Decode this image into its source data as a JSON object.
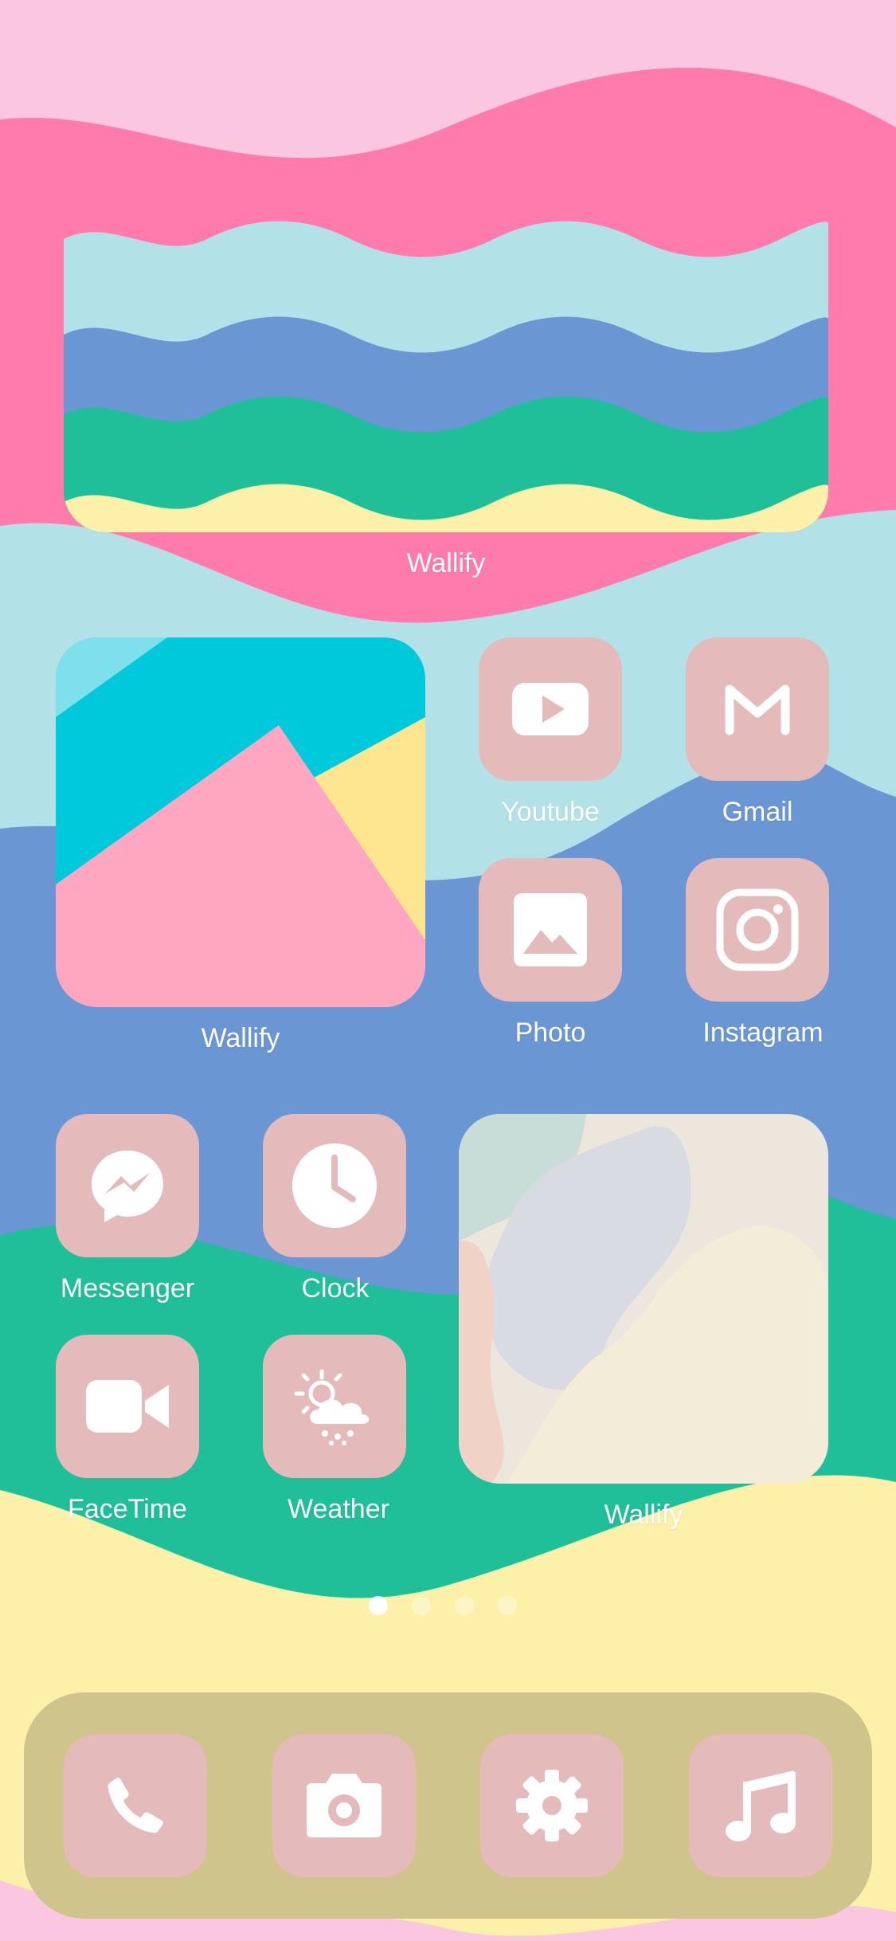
{
  "widgets": {
    "top": {
      "label": "Wallify"
    },
    "left": {
      "label": "Wallify"
    },
    "right": {
      "label": "Wallify"
    }
  },
  "apps": {
    "youtube": {
      "label": "Youtube",
      "icon": "youtube-icon"
    },
    "gmail": {
      "label": "Gmail",
      "icon": "gmail-icon"
    },
    "photo": {
      "label": "Photo",
      "icon": "photo-icon"
    },
    "instagram": {
      "label": "Instagram",
      "icon": "instagram-icon"
    },
    "messenger": {
      "label": "Messenger",
      "icon": "messenger-icon"
    },
    "clock": {
      "label": "Clock",
      "icon": "clock-icon"
    },
    "facetime": {
      "label": "FaceTime",
      "icon": "video-camera-icon"
    },
    "weather": {
      "label": "Weather",
      "icon": "weather-icon"
    }
  },
  "dock": [
    {
      "icon": "phone-icon"
    },
    {
      "icon": "camera-icon"
    },
    {
      "icon": "settings-icon"
    },
    {
      "icon": "music-icon"
    }
  ],
  "page_indicator": {
    "count": 4,
    "active_index": 0
  },
  "colors": {
    "pink_bg": "#fbc6e0",
    "hot_pink": "#ff7bac",
    "light_blue": "#b2e2e8",
    "blue": "#6a96d4",
    "green": "#1fbf9a",
    "yellow": "#fdf0a8",
    "app_tile": "#e4babb",
    "dock": "#cfc48b"
  }
}
